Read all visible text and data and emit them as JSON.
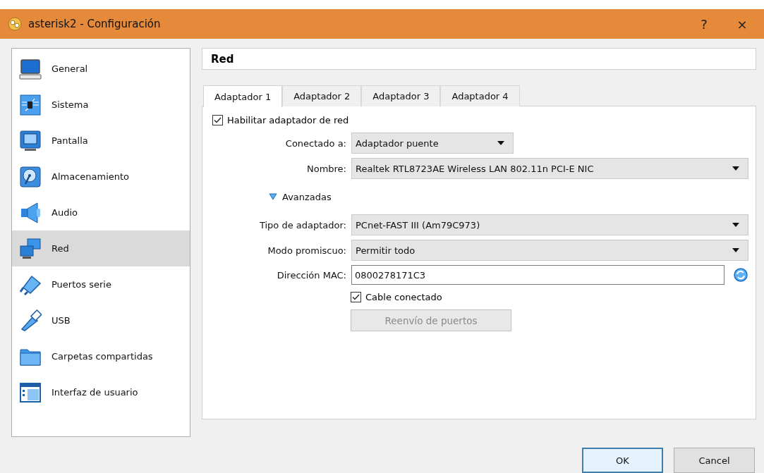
{
  "window": {
    "title": "asterisk2 - Configuración",
    "help": "?",
    "close": "×"
  },
  "sidebar": {
    "items": [
      {
        "label": "General",
        "selected": false
      },
      {
        "label": "Sistema",
        "selected": false
      },
      {
        "label": "Pantalla",
        "selected": false
      },
      {
        "label": "Almacenamiento",
        "selected": false
      },
      {
        "label": "Audio",
        "selected": false
      },
      {
        "label": "Red",
        "selected": true
      },
      {
        "label": "Puertos serie",
        "selected": false
      },
      {
        "label": "USB",
        "selected": false
      },
      {
        "label": "Carpetas compartidas",
        "selected": false
      },
      {
        "label": "Interfaz de usuario",
        "selected": false
      }
    ]
  },
  "page": {
    "title": "Red",
    "tabs": [
      {
        "label": "Adaptador 1",
        "selected": true
      },
      {
        "label": "Adaptador 2",
        "selected": false
      },
      {
        "label": "Adaptador 3",
        "selected": false
      },
      {
        "label": "Adaptador 4",
        "selected": false
      }
    ],
    "enable": {
      "label": "Habilitar adaptador de red",
      "checked": true
    },
    "fields": [
      {
        "kind": "combo",
        "label": "Conectado a:",
        "value": "Adaptador puente",
        "wide": false
      },
      {
        "kind": "combo",
        "label": "Nombre:",
        "value": "Realtek RTL8723AE Wireless LAN 802.11n PCI-E NIC",
        "wide": true
      }
    ],
    "advanced": {
      "label": "Avanzadas",
      "expanded": true
    },
    "advanced_fields": [
      {
        "kind": "combo",
        "label": "Tipo de adaptador:",
        "value": "PCnet-FAST III (Am79C973)",
        "wide": true
      },
      {
        "kind": "combo",
        "label": "Modo promiscuo:",
        "value": "Permitir todo",
        "wide": true
      },
      {
        "kind": "text",
        "label": "Dirección MAC:",
        "value": "0800278171C3",
        "wide": true
      }
    ],
    "cable": {
      "label": "Cable conectado",
      "checked": true
    },
    "port_forwarding": {
      "label": "Reenvío de puertos",
      "disabled": true
    }
  },
  "buttons": [
    {
      "label": "OK",
      "default": true
    },
    {
      "label": "Cancel",
      "default": false
    }
  ]
}
